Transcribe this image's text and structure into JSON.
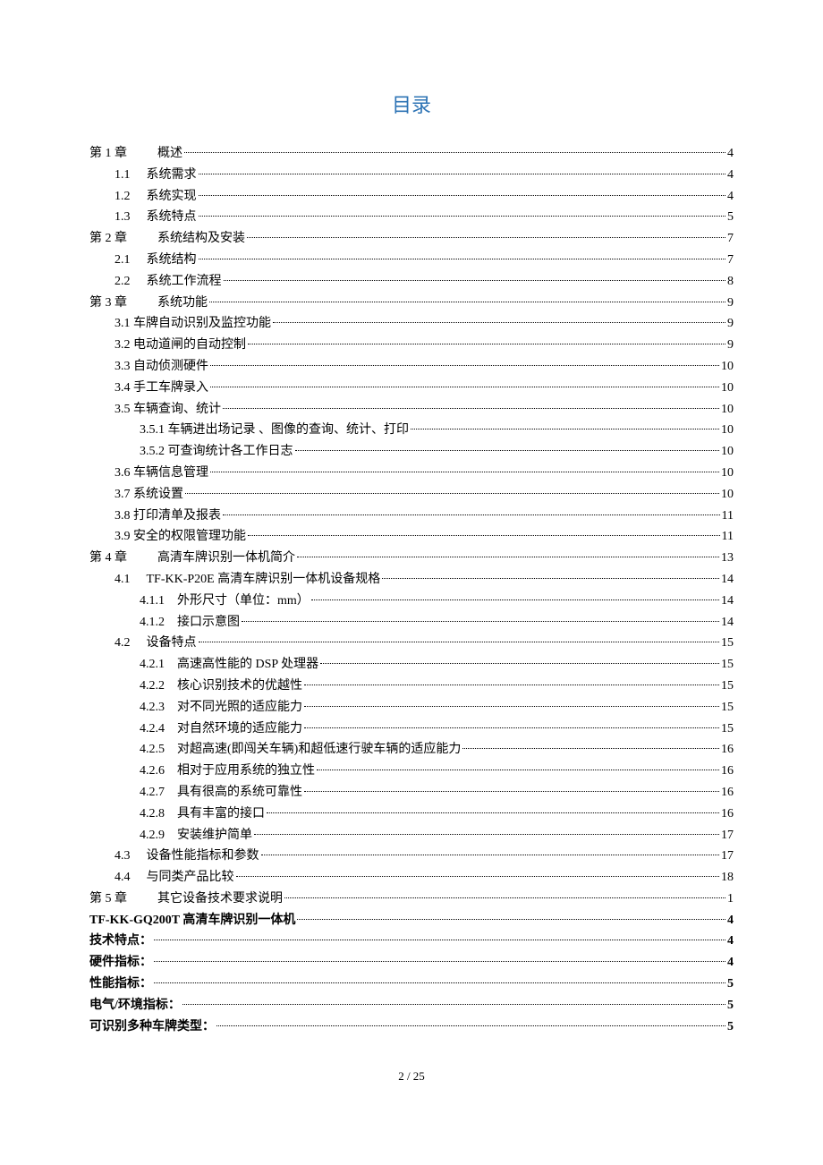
{
  "title": "目录",
  "footer": "2 / 25",
  "entries": [
    {
      "level": "lvl1",
      "bold": false,
      "num": "第 1 章",
      "gap": "gap1",
      "text": "概述",
      "page": "4"
    },
    {
      "level": "lvl2",
      "bold": false,
      "num": "1.1",
      "gap": "gap2",
      "text": "系统需求",
      "page": "4"
    },
    {
      "level": "lvl2",
      "bold": false,
      "num": "1.2",
      "gap": "gap2",
      "text": "系统实现",
      "page": "4"
    },
    {
      "level": "lvl2",
      "bold": false,
      "num": "1.3",
      "gap": "gap2",
      "text": "系统特点",
      "page": "5"
    },
    {
      "level": "lvl1",
      "bold": false,
      "num": "第 2 章",
      "gap": "gap1",
      "text": "系统结构及安装",
      "page": "7"
    },
    {
      "level": "lvl2",
      "bold": false,
      "num": "2.1",
      "gap": "gap2",
      "text": "系统结构",
      "page": "7"
    },
    {
      "level": "lvl2",
      "bold": false,
      "num": "2.2",
      "gap": "gap2",
      "text": "系统工作流程",
      "page": "8"
    },
    {
      "level": "lvl1",
      "bold": false,
      "num": "第 3 章",
      "gap": "gap1",
      "text": "系统功能",
      "page": "9"
    },
    {
      "level": "lvl2b",
      "bold": false,
      "num": "3.1",
      "gap": "",
      "text": " 车牌自动识别及监控功能",
      "page": "9"
    },
    {
      "level": "lvl2b",
      "bold": false,
      "num": "3.2",
      "gap": "",
      "text": " 电动道闸的自动控制",
      "page": "9"
    },
    {
      "level": "lvl2b",
      "bold": false,
      "num": "3.3",
      "gap": "",
      "text": " 自动侦测硬件",
      "page": "10"
    },
    {
      "level": "lvl2b",
      "bold": false,
      "num": "3.4",
      "gap": "",
      "text": " 手工车牌录入",
      "page": "10"
    },
    {
      "level": "lvl2b",
      "bold": false,
      "num": "3.5",
      "gap": "",
      "text": " 车辆查询、统计",
      "page": "10"
    },
    {
      "level": "lvl3b",
      "bold": false,
      "num": "3.5.1",
      "gap": "",
      "text": " 车辆进出场记录 、图像的查询、统计、打印",
      "page": "10"
    },
    {
      "level": "lvl3b",
      "bold": false,
      "num": "3.5.2",
      "gap": "",
      "text": " 可查询统计各工作日志",
      "page": "10"
    },
    {
      "level": "lvl2b",
      "bold": false,
      "num": "3.6",
      "gap": "",
      "text": " 车辆信息管理",
      "page": "10"
    },
    {
      "level": "lvl2b",
      "bold": false,
      "num": "3.7",
      "gap": "",
      "text": " 系统设置",
      "page": "10"
    },
    {
      "level": "lvl2b",
      "bold": false,
      "num": "3.8",
      "gap": "",
      "text": " 打印清单及报表",
      "page": "11"
    },
    {
      "level": "lvl2b",
      "bold": false,
      "num": "3.9",
      "gap": "",
      "text": " 安全的权限管理功能",
      "page": "11"
    },
    {
      "level": "lvl1",
      "bold": false,
      "num": "第 4 章",
      "gap": "gap1",
      "text": "高清车牌识别一体机简介",
      "page": "13"
    },
    {
      "level": "lvl2",
      "bold": false,
      "num": "4.1",
      "gap": "gap2",
      "text": "TF-KK-P20E 高清车牌识别一体机设备规格",
      "page": "14"
    },
    {
      "level": "lvl3",
      "bold": false,
      "num": "4.1.1",
      "gap": "gap3",
      "text": "外形尺寸（单位：mm）",
      "page": "14"
    },
    {
      "level": "lvl3",
      "bold": false,
      "num": "4.1.2",
      "gap": "gap3",
      "text": "接口示意图",
      "page": "14"
    },
    {
      "level": "lvl2",
      "bold": false,
      "num": "4.2",
      "gap": "gap2",
      "text": "设备特点",
      "page": "15"
    },
    {
      "level": "lvl3",
      "bold": false,
      "num": "4.2.1",
      "gap": "gap3",
      "text": "高速高性能的 DSP 处理器",
      "page": "15"
    },
    {
      "level": "lvl3",
      "bold": false,
      "num": "4.2.2",
      "gap": "gap3",
      "text": "核心识别技术的优越性",
      "page": "15"
    },
    {
      "level": "lvl3",
      "bold": false,
      "num": "4.2.3",
      "gap": "gap3",
      "text": "对不同光照的适应能力",
      "page": "15"
    },
    {
      "level": "lvl3",
      "bold": false,
      "num": "4.2.4",
      "gap": "gap3",
      "text": "对自然环境的适应能力",
      "page": "15"
    },
    {
      "level": "lvl3",
      "bold": false,
      "num": "4.2.5",
      "gap": "gap3",
      "text": "对超高速(即闯关车辆)和超低速行驶车辆的适应能力",
      "page": "16"
    },
    {
      "level": "lvl3",
      "bold": false,
      "num": "4.2.6",
      "gap": "gap3",
      "text": "相对于应用系统的独立性",
      "page": "16"
    },
    {
      "level": "lvl3",
      "bold": false,
      "num": "4.2.7",
      "gap": "gap3",
      "text": "具有很高的系统可靠性",
      "page": "16"
    },
    {
      "level": "lvl3",
      "bold": false,
      "num": "4.2.8",
      "gap": "gap3",
      "text": "具有丰富的接口",
      "page": "16"
    },
    {
      "level": "lvl3",
      "bold": false,
      "num": "4.2.9",
      "gap": "gap3",
      "text": "安装维护简单",
      "page": "17"
    },
    {
      "level": "lvl2",
      "bold": false,
      "num": "4.3",
      "gap": "gap2",
      "text": "设备性能指标和参数",
      "page": "17"
    },
    {
      "level": "lvl2",
      "bold": false,
      "num": "4.4",
      "gap": "gap2",
      "text": "与同类产品比较",
      "page": "18"
    },
    {
      "level": "lvl1",
      "bold": false,
      "num": "第 5 章",
      "gap": "gap1",
      "text": "其它设备技术要求说明",
      "page": "1"
    },
    {
      "level": "lvl1",
      "bold": true,
      "num": "",
      "gap": "",
      "text": "TF-KK-GQ200T 高清车牌识别一体机",
      "page": "4"
    },
    {
      "level": "lvl1",
      "bold": true,
      "num": "",
      "gap": "",
      "text": "技术特点：",
      "page": "4"
    },
    {
      "level": "lvl1",
      "bold": true,
      "num": "",
      "gap": "",
      "text": "硬件指标：",
      "page": "4"
    },
    {
      "level": "lvl1",
      "bold": true,
      "num": "",
      "gap": "",
      "text": "性能指标：",
      "page": "5"
    },
    {
      "level": "lvl1",
      "bold": true,
      "num": "",
      "gap": "",
      "text": "电气/环境指标：",
      "page": "5"
    },
    {
      "level": "lvl1",
      "bold": true,
      "num": "",
      "gap": "",
      "text": "可识别多种车牌类型：",
      "page": "5"
    }
  ]
}
